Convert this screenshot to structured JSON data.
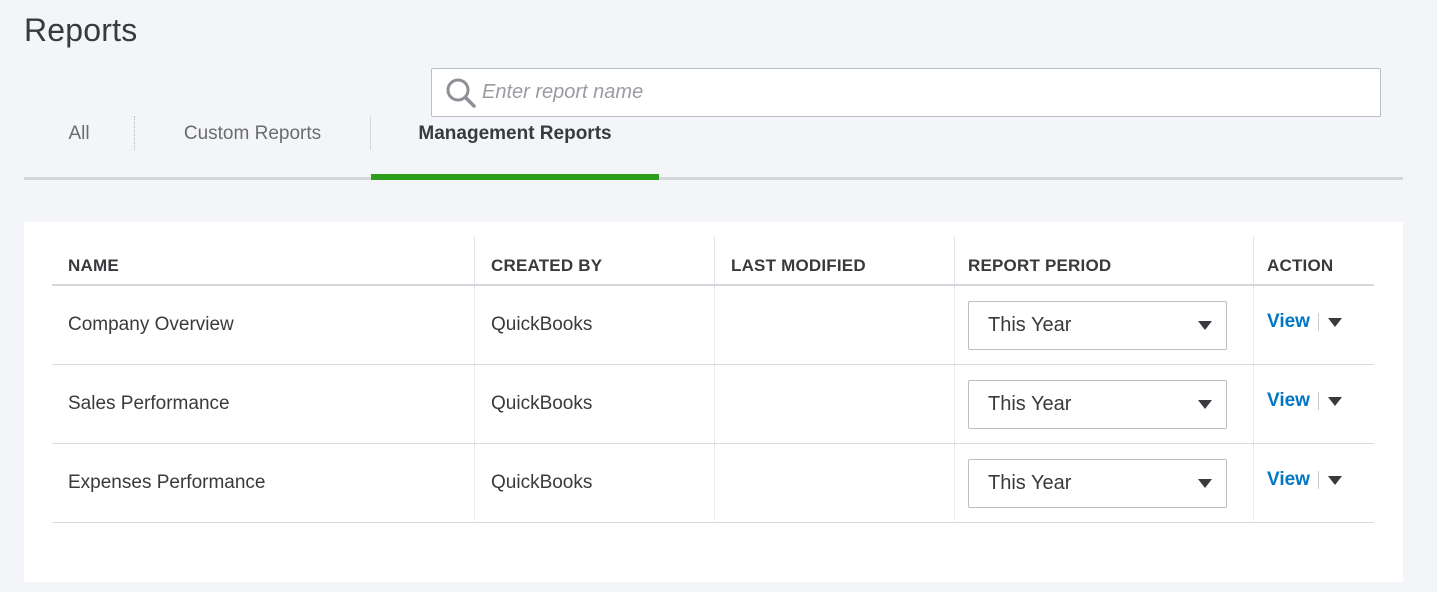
{
  "page": {
    "title": "Reports"
  },
  "search": {
    "placeholder": "Enter report name",
    "value": ""
  },
  "tabs": [
    {
      "label": "All",
      "active": false
    },
    {
      "label": "Custom Reports",
      "active": false
    },
    {
      "label": "Management Reports",
      "active": true
    }
  ],
  "table": {
    "headers": {
      "name": "NAME",
      "created_by": "CREATED BY",
      "last_modified": "LAST MODIFIED",
      "report_period": "REPORT PERIOD",
      "action": "ACTION"
    },
    "rows": [
      {
        "name": "Company Overview",
        "created_by": "QuickBooks",
        "last_modified": "",
        "report_period": "This Year",
        "action": "View"
      },
      {
        "name": "Sales Performance",
        "created_by": "QuickBooks",
        "last_modified": "",
        "report_period": "This Year",
        "action": "View"
      },
      {
        "name": "Expenses Performance",
        "created_by": "QuickBooks",
        "last_modified": "",
        "report_period": "This Year",
        "action": "View"
      }
    ]
  },
  "icons": {
    "search": "search-icon",
    "dropdown": "chevron-down-icon",
    "action_menu": "caret-down-icon"
  },
  "colors": {
    "accent": "#2ca01c",
    "link": "#0077c5",
    "text": "#393a3d",
    "background": "#f4f5f8"
  }
}
